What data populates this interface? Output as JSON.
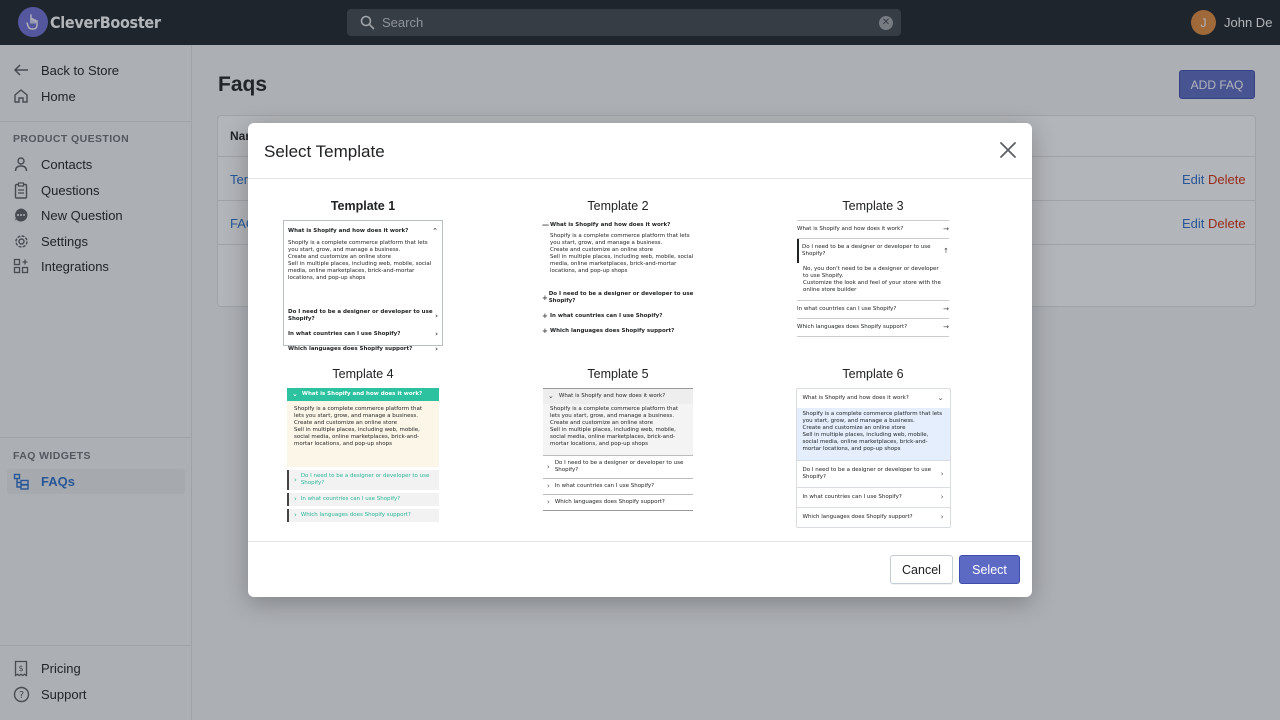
{
  "app": {
    "logo_text": "CleverBooster",
    "search_placeholder": "Search",
    "user_initial": "J",
    "user_name": "John De"
  },
  "sidebar": {
    "back": "Back to Store",
    "home": "Home",
    "section1": "PRODUCT QUESTION",
    "items": [
      "Contacts",
      "Questions",
      "New Question",
      "Settings",
      "Integrations"
    ],
    "section2": "FAQ WIDGETS",
    "faqs": "FAQs",
    "pricing": "Pricing",
    "support": "Support"
  },
  "main": {
    "title": "Faqs",
    "add_button": "ADD FAQ",
    "table_header": "Nar",
    "rows": [
      {
        "name": "Tem",
        "edit": "Edit",
        "delete": "Delete"
      },
      {
        "name": "FAQ",
        "edit": "Edit",
        "delete": "Delete"
      }
    ]
  },
  "modal": {
    "title": "Select Template",
    "cancel": "Cancel",
    "select": "Select",
    "templates": [
      "Template 1",
      "Template 2",
      "Template 3",
      "Template 4",
      "Template 5",
      "Template 6"
    ],
    "preview": {
      "q1": "What is Shopify and how does it work?",
      "q2": "Do I need to be a designer or developer to use Shopify?",
      "q3": "In what countries can I use Shopify?",
      "q4": "Which languages does Shopify support?",
      "a1": "Shopify is a complete commerce platform that lets you start, grow, and manage a business.",
      "a2": "Create and customize an online store",
      "a3": "Sell in multiple places, including web, mobile, social media, online marketplaces, brick-and-mortar locations, and pop-up shops",
      "a_t3_1": "No, you don't need to be a designer or developer to use Shopify.",
      "a_t3_2": "Customize the look and feel of your store with the online store builder"
    }
  },
  "colors": {
    "accent": "#5c6ac4",
    "topbar": "#1c2229",
    "link": "#2c6ecb",
    "danger": "#d72c0d",
    "teal": "#2cc2a0"
  }
}
